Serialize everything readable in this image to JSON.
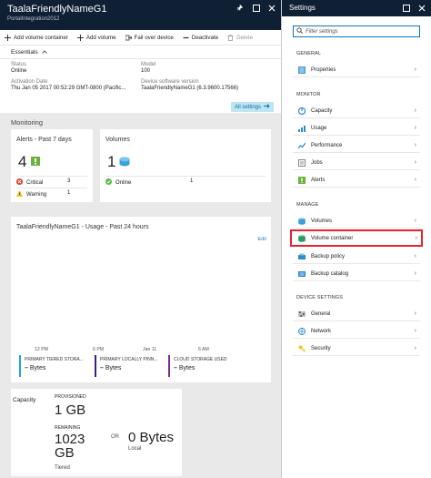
{
  "left_blade": {
    "title": "TaalaFriendlyNameG1",
    "subtitle": "PortalIntegration2012",
    "toolbar": {
      "add_volume_container": "Add volume container",
      "add_volume": "Add volume",
      "fail_over": "Fail over device",
      "deactivate": "Deactivate",
      "delete": "Delete"
    },
    "essentials_label": "Essentials",
    "status_label": "Status",
    "status_value": "Online",
    "model_label": "Model",
    "model_value": "100",
    "activation_label": "Activation Date",
    "activation_value": "Thu Jan 05 2017 00:52:29 GMT-0800 (Pacific...",
    "software_label": "Device software version",
    "software_value": "TaalaFriendlyNameG1 (6.3.9600.17566)",
    "all_settings": "All settings"
  },
  "monitoring": {
    "label": "Monitoring",
    "alerts": {
      "title": "Alerts - Past 7 days",
      "count": "4",
      "critical_label": "Critical",
      "critical_count": "3",
      "warning_label": "Warning",
      "warning_count": "1"
    },
    "volumes": {
      "title": "Volumes",
      "count": "1",
      "online_label": "Online",
      "online_count": "1"
    },
    "usage": {
      "title": "TaalaFriendlyNameG1 - Usage - Past 24 hours",
      "edit": "Edit",
      "x_ticks": [
        "12 PM",
        "6 PM",
        "Jan 11",
        "6 AM"
      ],
      "legend": [
        {
          "name": "PRIMARY TIERED STORA...",
          "value": "Bytes",
          "color": "#1ea5e0"
        },
        {
          "name": "PRIMARY LOCALLY PINN...",
          "value": "Bytes",
          "color": "#3a1e8a"
        },
        {
          "name": "CLOUD STORAGE USED",
          "value": "Bytes",
          "color": "#7a2c8c"
        }
      ]
    }
  },
  "capacity": {
    "label": "Capacity",
    "provisioned_label": "PROVISIONED",
    "provisioned_value": "1 GB",
    "remaining_label": "REMAINING",
    "remaining_value": "1023 GB",
    "tiered_label": "Tiered",
    "or_label": "OR",
    "local_value": "0 Bytes",
    "local_label": "Local"
  },
  "settings_blade": {
    "title": "Settings",
    "filter_placeholder": "Filter settings",
    "general_label": "GENERAL",
    "properties": "Properties",
    "monitor_label": "MONITOR",
    "capacity": "Capacity",
    "usage": "Usage",
    "performance": "Performance",
    "jobs": "Jobs",
    "alerts": "Alerts",
    "manage_label": "MANAGE",
    "volumes": "Volumes",
    "volume_container": "Volume container",
    "backup_policy": "Backup policy",
    "backup_catalog": "Backup catalog",
    "device_settings_label": "DEVICE SETTINGS",
    "general": "General",
    "network": "Network",
    "security": "Security"
  },
  "colors": {
    "header_bg": "#0f1f34",
    "accent": "#0a74c0",
    "selected_border": "#e8242b",
    "critical": "#e03a2c",
    "warning": "#f0c419",
    "online": "#58b947"
  }
}
